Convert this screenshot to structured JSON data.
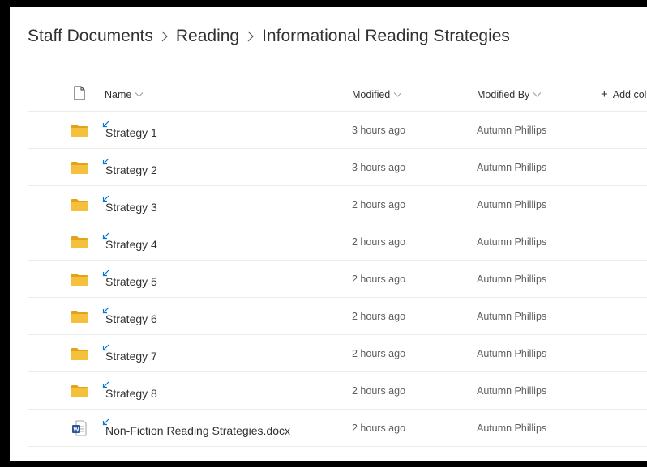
{
  "breadcrumb": {
    "items": [
      "Staff Documents",
      "Reading",
      "Informational Reading Strategies"
    ]
  },
  "columns": {
    "name": "Name",
    "modified": "Modified",
    "modified_by": "Modified By",
    "add_column": "Add col"
  },
  "icons": {
    "file_type_header": "document-icon",
    "folder": "folder-icon",
    "word": "word-document-icon",
    "new_badge": "new-item-badge-icon",
    "sort": "chevron-down-icon",
    "breadcrumb_separator": "chevron-right-icon"
  },
  "colors": {
    "folder": "#f5c13c",
    "folder_dark": "#e3a21a",
    "word_blue": "#2b579a",
    "new_badge": "#0078d4"
  },
  "rows": [
    {
      "type": "folder",
      "name": "Strategy 1",
      "modified": "3 hours ago",
      "modified_by": "Autumn Phillips"
    },
    {
      "type": "folder",
      "name": "Strategy 2",
      "modified": "3 hours ago",
      "modified_by": "Autumn Phillips"
    },
    {
      "type": "folder",
      "name": "Strategy 3",
      "modified": "2 hours ago",
      "modified_by": "Autumn Phillips"
    },
    {
      "type": "folder",
      "name": "Strategy 4",
      "modified": "2 hours ago",
      "modified_by": "Autumn Phillips"
    },
    {
      "type": "folder",
      "name": "Strategy 5",
      "modified": "2 hours ago",
      "modified_by": "Autumn Phillips"
    },
    {
      "type": "folder",
      "name": "Strategy 6",
      "modified": "2 hours ago",
      "modified_by": "Autumn Phillips"
    },
    {
      "type": "folder",
      "name": "Strategy 7",
      "modified": "2 hours ago",
      "modified_by": "Autumn Phillips"
    },
    {
      "type": "folder",
      "name": "Strategy 8",
      "modified": "2 hours ago",
      "modified_by": "Autumn Phillips"
    },
    {
      "type": "word",
      "name": "Non-Fiction Reading Strategies.docx",
      "modified": "2 hours ago",
      "modified_by": "Autumn Phillips"
    }
  ]
}
